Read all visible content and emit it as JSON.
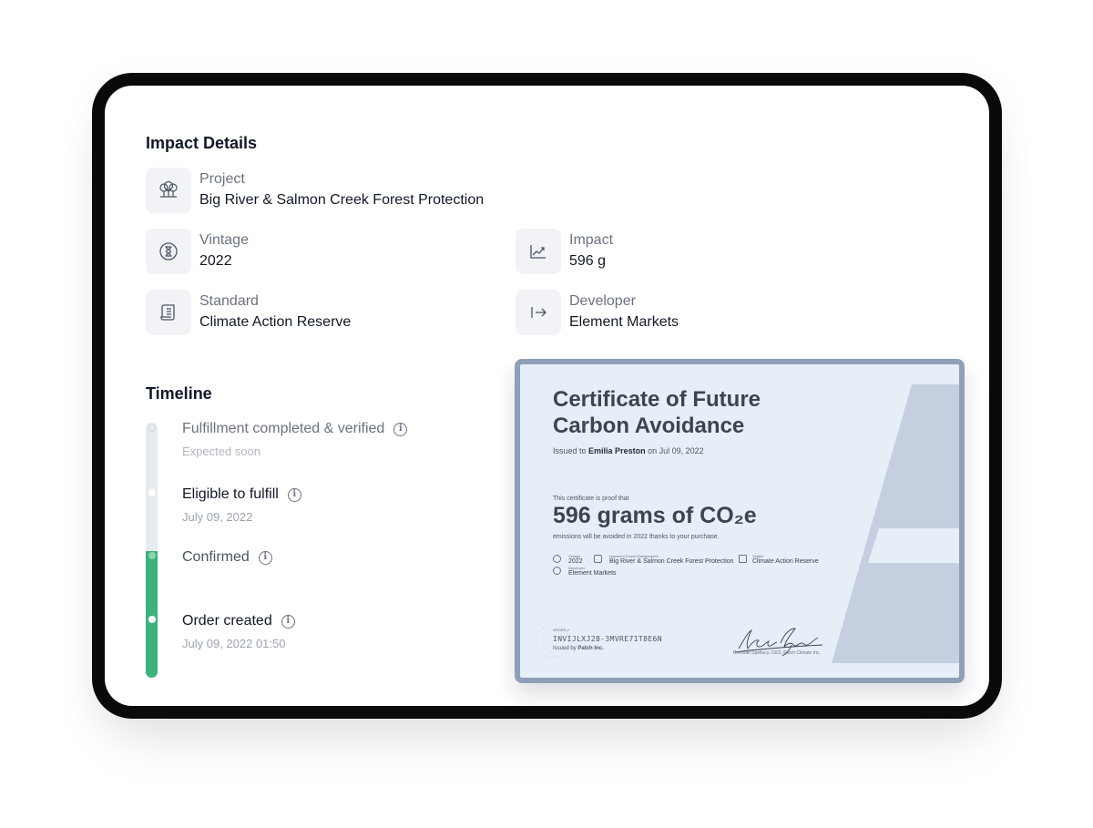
{
  "impact_details": {
    "title": "Impact Details",
    "project": {
      "label": "Project",
      "value": "Big River & Salmon Creek Forest Protection",
      "icon": "trees-icon"
    },
    "vintage": {
      "label": "Vintage",
      "value": "2022",
      "icon": "hourglass-icon"
    },
    "impact": {
      "label": "Impact",
      "value": "596 g",
      "icon": "trend-icon"
    },
    "standard": {
      "label": "Standard",
      "value": "Climate Action Reserve",
      "icon": "scroll-icon"
    },
    "developer": {
      "label": "Developer",
      "value": "Element Markets",
      "icon": "arrow-to-line-icon"
    }
  },
  "timeline": {
    "title": "Timeline",
    "steps": [
      {
        "label": "Fulfillment completed & verified",
        "sub": "Expected soon",
        "status": "pending"
      },
      {
        "label": "Eligible to fulfill",
        "sub": "July 09, 2022",
        "status": "pending"
      },
      {
        "label": "Confirmed",
        "sub": "",
        "status": "done"
      },
      {
        "label": "Order created",
        "sub": "July 09, 2022 01:50",
        "status": "done"
      }
    ],
    "info_glyph": "i"
  },
  "certificate": {
    "title": "Certificate of Future Carbon Avoidance",
    "issued_prefix": "Issued to",
    "recipient": "Emilia Preston",
    "issued_suffix": "on Jul 09, 2022",
    "proof_text": "This certificate is proof that",
    "amount": "596 grams of CO₂e",
    "avoid_text": "emissions will be avoided in 2022 thanks to your purchase.",
    "meta": {
      "vintage_label": "Vintage",
      "vintage": "2022",
      "project_label": "Improved Forest Management",
      "project": "Big River & Salmon Creek Forest Protection",
      "verifier_label": "Verifier",
      "verifier": "Climate Action Reserve",
      "developer_label": "Developer",
      "developer": "Element Markets"
    },
    "code_label": "ORDER #",
    "code": "INVIJLXJ28-3MVRE71T8E6N",
    "issuer_prefix": "Issued by",
    "issuer": "Patch Inc.",
    "signature_caption": "Brennan Spellacy, CEO, Patch Climate Inc."
  },
  "colors": {
    "accent_green": "#3cb27d",
    "cert_border": "#8fa0b6",
    "cert_bg": "#e8eef8"
  }
}
